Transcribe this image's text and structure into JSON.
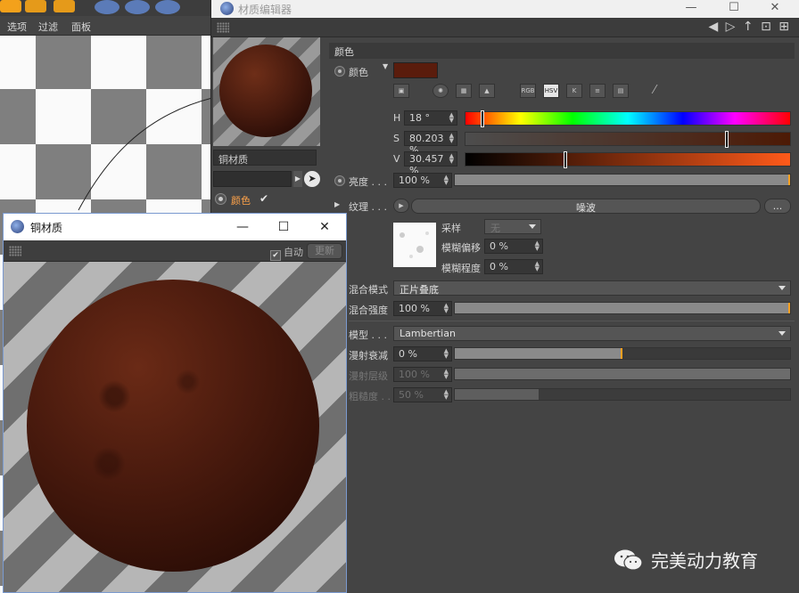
{
  "background_app": {
    "menu": [
      "选项",
      "过滤",
      "面板"
    ]
  },
  "editor": {
    "title": "材质编辑器",
    "window_controls": {
      "minimize": "—",
      "maximize": "☐",
      "close": "✕"
    },
    "material_name": "铜材质",
    "channel": {
      "label": "颜色",
      "enabled": true
    },
    "section_title": "颜色",
    "color": {
      "label": "颜色",
      "swatch": "#5a1c0c",
      "modes": [
        "RGB",
        "HSV",
        "K"
      ],
      "h": {
        "label": "H",
        "value": "18 °",
        "marker_fraction": 0.05
      },
      "s": {
        "label": "S",
        "value": "80.203 %",
        "marker_fraction": 0.802
      },
      "v": {
        "label": "V",
        "value": "30.457 %",
        "marker_fraction": 0.305
      }
    },
    "brightness": {
      "label": "亮度 . . .",
      "value": "100 %",
      "fraction": 1.0
    },
    "texture": {
      "label": "纹理 . . .",
      "shader": "噪波",
      "more": "...",
      "sampling": {
        "label": "采样",
        "value": "无"
      },
      "blur_offset": {
        "label": "模糊偏移",
        "value": "0 %"
      },
      "blur_strength": {
        "label": "模糊程度",
        "value": "0 %"
      }
    },
    "mix_mode": {
      "label": "混合模式",
      "value": "正片叠底"
    },
    "mix_strength": {
      "label": "混合强度",
      "value": "100 %",
      "fraction": 1.0
    },
    "model": {
      "label": "模型 . . .",
      "value": "Lambertian"
    },
    "diffuse_falloff": {
      "label": "漫射衰减",
      "value": "0 %",
      "fraction": 0.5
    },
    "diffuse_level": {
      "label": "漫射层级",
      "value": "100 %",
      "fraction": 1.0
    },
    "roughness": {
      "label": "粗糙度 . .",
      "value": "50 %",
      "fraction": 0.25
    }
  },
  "preview_window": {
    "title": "铜材质",
    "controls": {
      "minimize": "—",
      "maximize": "☐",
      "close": "✕"
    },
    "auto_label": "自动",
    "update_button": "更新"
  },
  "watermark": {
    "text": "完美动力教育"
  },
  "colors": {
    "accent": "#ffa020",
    "copper": "#4b1b0e",
    "panel": "#444444"
  }
}
